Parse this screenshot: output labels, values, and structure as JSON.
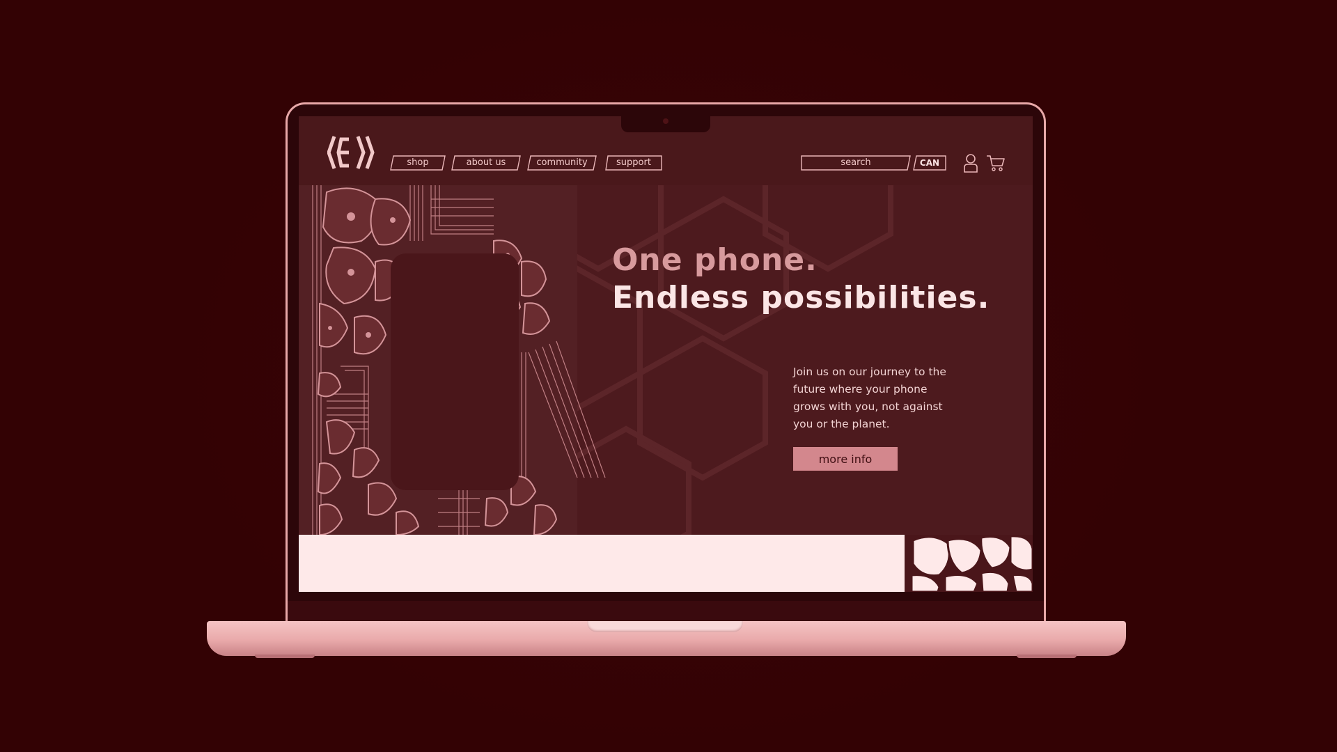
{
  "colors": {
    "background": "#330204",
    "screen": "#4d1a1e",
    "accent": "#d3878d",
    "laptop_body": "#e9a9aa",
    "light_band": "#fee9e9"
  },
  "header": {
    "logo_icon": "bracket-e-logo",
    "nav": [
      {
        "label": "shop"
      },
      {
        "label": "about us"
      },
      {
        "label": "community"
      },
      {
        "label": "support"
      }
    ],
    "search_placeholder": "search",
    "currency": "CAN",
    "account_icon": "user-icon",
    "cart_icon": "cart-icon"
  },
  "hero": {
    "headline_line1": "One phone.",
    "headline_line2": "Endless possibilities.",
    "description": "Join us on our journey to the future where your phone grows with you, not against you or the planet.",
    "cta_label": "more info"
  }
}
